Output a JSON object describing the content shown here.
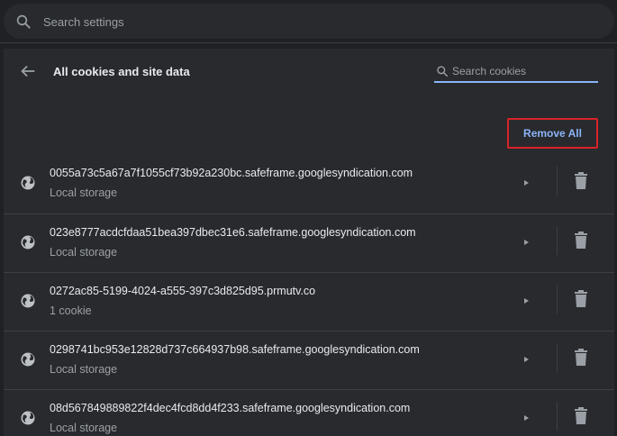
{
  "search": {
    "placeholder": "Search settings"
  },
  "header": {
    "title": "All cookies and site data",
    "cookie_search_placeholder": "Search cookies"
  },
  "actions": {
    "remove_all_label": "Remove All"
  },
  "colors": {
    "accent": "#8ab4f8",
    "highlight_border": "#d9222a",
    "background": "#202124",
    "card": "#292a2d"
  },
  "icons": {
    "search": "search-icon",
    "back": "arrow-back-icon",
    "site": "globe-icon",
    "expand": "arrow-right-icon",
    "delete": "trash-icon"
  },
  "sites": [
    {
      "name": "0055a73c5a67a7f1055cf73b92a230bc.safeframe.googlesyndication.com",
      "detail": "Local storage"
    },
    {
      "name": "023e8777acdcfdaa51bea397dbec31e6.safeframe.googlesyndication.com",
      "detail": "Local storage"
    },
    {
      "name": "0272ac85-5199-4024-a555-397c3d825d95.prmutv.co",
      "detail": "1 cookie"
    },
    {
      "name": "0298741bc953e12828d737c664937b98.safeframe.googlesyndication.com",
      "detail": "Local storage"
    },
    {
      "name": "08d567849889822f4dec4fcd8dd4f233.safeframe.googlesyndication.com",
      "detail": "Local storage"
    }
  ]
}
